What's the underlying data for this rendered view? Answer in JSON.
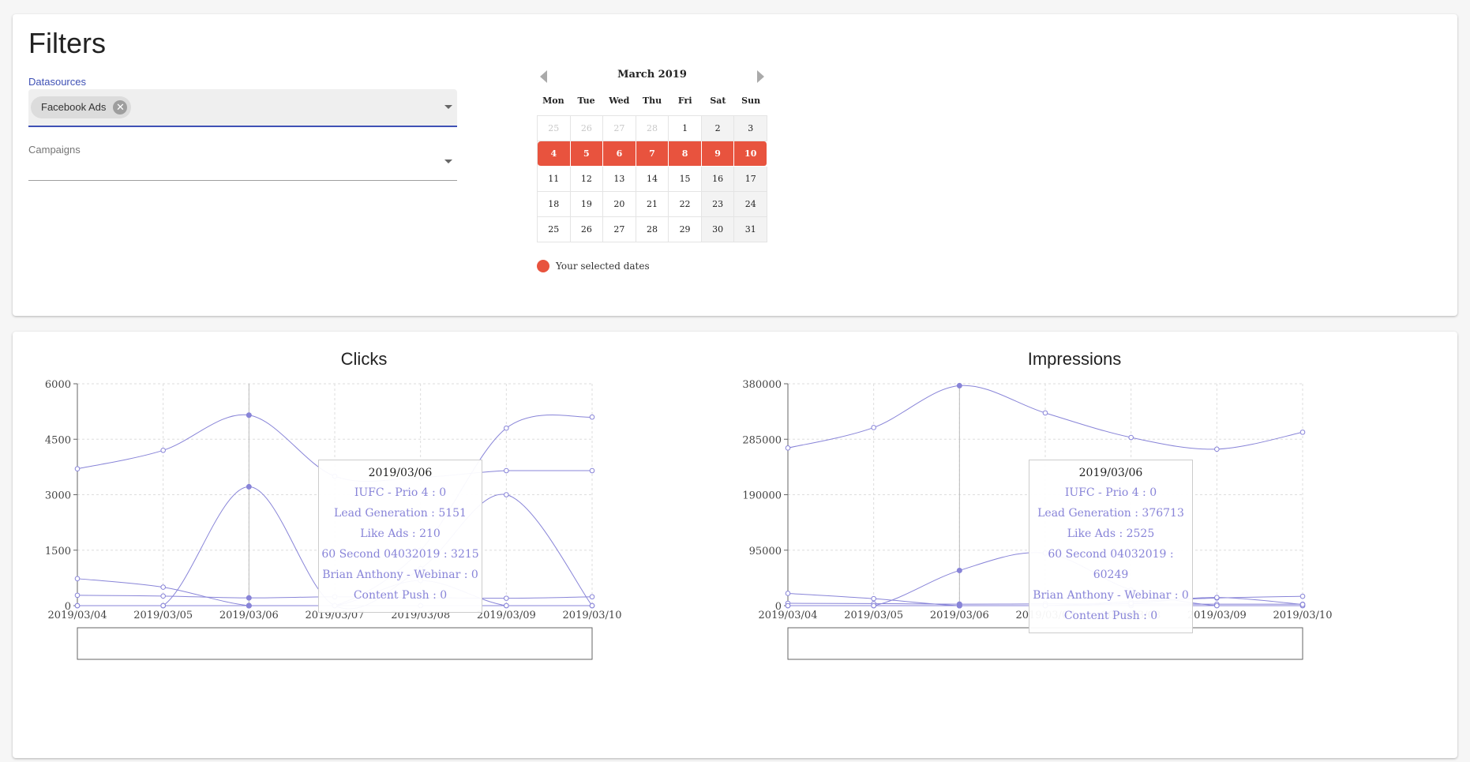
{
  "filters": {
    "title": "Filters",
    "datasources": {
      "label": "Datasources",
      "chips": [
        "Facebook Ads"
      ]
    },
    "campaigns": {
      "label": "Campaigns",
      "value": ""
    }
  },
  "calendar": {
    "month_label": "March 2019",
    "weekdays": [
      "Mon",
      "Tue",
      "Wed",
      "Thu",
      "Fri",
      "Sat",
      "Sun"
    ],
    "weeks": [
      [
        {
          "d": "25",
          "muted": true
        },
        {
          "d": "26",
          "muted": true
        },
        {
          "d": "27",
          "muted": true
        },
        {
          "d": "28",
          "muted": true
        },
        {
          "d": "1"
        },
        {
          "d": "2"
        },
        {
          "d": "3"
        }
      ],
      [
        {
          "d": "4",
          "sel": true
        },
        {
          "d": "5",
          "sel": true
        },
        {
          "d": "6",
          "sel": true
        },
        {
          "d": "7",
          "sel": true
        },
        {
          "d": "8",
          "sel": true
        },
        {
          "d": "9",
          "sel": true
        },
        {
          "d": "10",
          "sel": true
        }
      ],
      [
        {
          "d": "11"
        },
        {
          "d": "12"
        },
        {
          "d": "13"
        },
        {
          "d": "14"
        },
        {
          "d": "15"
        },
        {
          "d": "16"
        },
        {
          "d": "17"
        }
      ],
      [
        {
          "d": "18"
        },
        {
          "d": "19"
        },
        {
          "d": "20"
        },
        {
          "d": "21"
        },
        {
          "d": "22"
        },
        {
          "d": "23"
        },
        {
          "d": "24"
        }
      ],
      [
        {
          "d": "25"
        },
        {
          "d": "26"
        },
        {
          "d": "27"
        },
        {
          "d": "28"
        },
        {
          "d": "29"
        },
        {
          "d": "30"
        },
        {
          "d": "31"
        }
      ]
    ],
    "legend": "Your selected dates",
    "selected_color": "#e8533e"
  },
  "chart_data": [
    {
      "type": "line",
      "title": "Clicks",
      "x": [
        "2019/03/04",
        "2019/03/05",
        "2019/03/06",
        "2019/03/07",
        "2019/03/08",
        "2019/03/09",
        "2019/03/10"
      ],
      "ylim": [
        0,
        6000
      ],
      "yticks": [
        "0",
        "1500",
        "3000",
        "4500",
        "6000"
      ],
      "grid": true,
      "color": "#8884d8",
      "active_x": "2019/03/06",
      "series": [
        {
          "name": "IUFC - Prio 4",
          "values": [
            0,
            0,
            0,
            0,
            0,
            0,
            0
          ]
        },
        {
          "name": "Lead Generation",
          "values": [
            3700,
            4200,
            5151,
            3500,
            3470,
            3650,
            3650
          ]
        },
        {
          "name": "Like Ads",
          "values": [
            280,
            260,
            210,
            240,
            220,
            200,
            240
          ]
        },
        {
          "name": "60 Second 04032019",
          "values": [
            0,
            0,
            3215,
            0,
            1000,
            3000,
            0
          ]
        },
        {
          "name": "Brian Anthony - Webinar",
          "values": [
            0,
            0,
            0,
            0,
            1500,
            4800,
            5100
          ]
        },
        {
          "name": "Content Push",
          "values": [
            730,
            500,
            0,
            0,
            680,
            0,
            0
          ]
        }
      ],
      "tooltip": {
        "title": "2019/03/06",
        "rows": [
          "IUFC - Prio 4 : 0",
          "Lead Generation : 5151",
          "Like Ads : 210",
          "60 Second 04032019 : 3215",
          "Brian Anthony - Webinar : 0",
          "Content Push : 0"
        ]
      }
    },
    {
      "type": "line",
      "title": "Impressions",
      "x": [
        "2019/03/04",
        "2019/03/05",
        "2019/03/06",
        "2019/03/07",
        "2019/03/08",
        "2019/03/09",
        "2019/03/10"
      ],
      "ylim": [
        0,
        380000
      ],
      "yticks": [
        "0",
        "95000",
        "190000",
        "285000",
        "380000"
      ],
      "grid": true,
      "color": "#8884d8",
      "active_x": "2019/03/06",
      "series": [
        {
          "name": "IUFC - Prio 4",
          "values": [
            0,
            0,
            0,
            0,
            0,
            0,
            0
          ]
        },
        {
          "name": "Lead Generation",
          "values": [
            270000,
            305000,
            376713,
            330000,
            288000,
            268000,
            297000
          ]
        },
        {
          "name": "Like Ads",
          "values": [
            4000,
            3500,
            2525,
            3000,
            3000,
            2500,
            2500
          ]
        },
        {
          "name": "60 Second 04032019",
          "values": [
            0,
            0,
            60249,
            90000,
            27000,
            0,
            0
          ]
        },
        {
          "name": "Brian Anthony - Webinar",
          "values": [
            0,
            0,
            0,
            0,
            7000,
            13000,
            16000
          ]
        },
        {
          "name": "Content Push",
          "values": [
            21000,
            12000,
            0,
            0,
            4000,
            14000,
            2000
          ]
        }
      ],
      "tooltip": {
        "title": "2019/03/06",
        "rows": [
          "IUFC - Prio 4 : 0",
          "Lead Generation : 376713",
          "Like Ads : 2525",
          "60 Second 04032019 : 60249",
          "Brian Anthony - Webinar : 0",
          "Content Push : 0"
        ]
      }
    }
  ]
}
